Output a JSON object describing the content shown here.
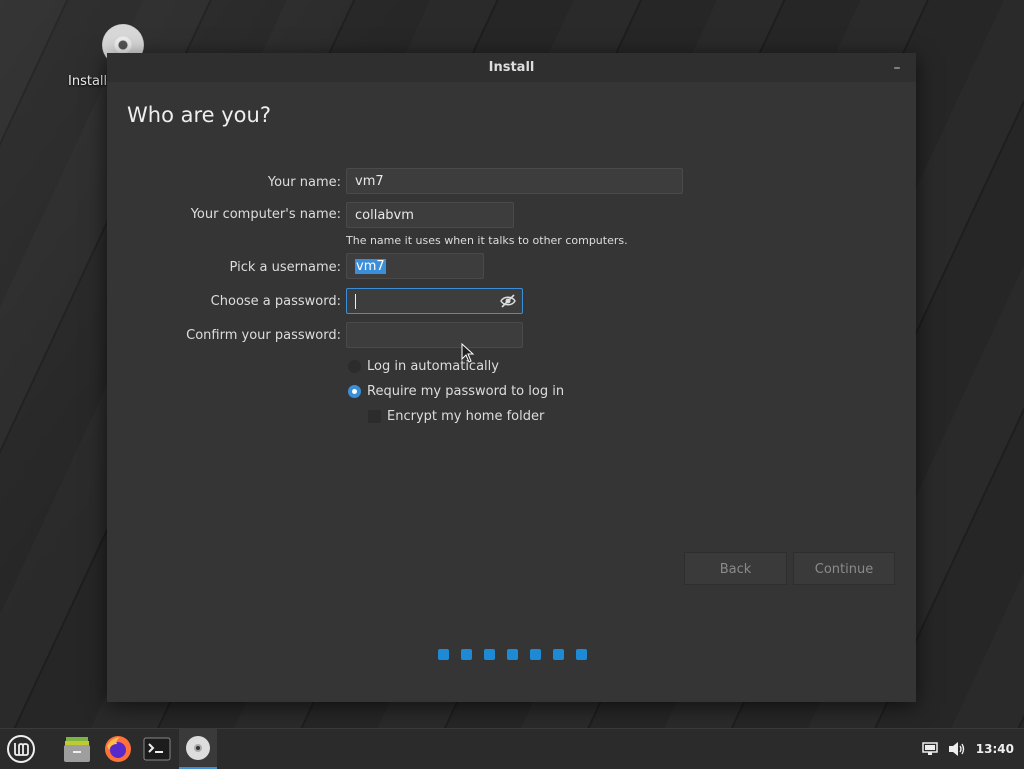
{
  "desktop": {
    "install_icon_label": "Install"
  },
  "window": {
    "title": "Install",
    "heading": "Who are you?",
    "form": {
      "name_label": "Your name:",
      "name_value": "vm7",
      "computer_label": "Your computer's name:",
      "computer_value": "collabvm",
      "computer_hint": "The name it uses when it talks to other computers.",
      "username_label": "Pick a username:",
      "username_value": "vm7",
      "password_label": "Choose a password:",
      "password_value": "",
      "confirm_label": "Confirm your password:",
      "confirm_value": ""
    },
    "options": {
      "auto_login": "Log in automatically",
      "require_password": "Require my password to log in",
      "encrypt_home": "Encrypt my home folder"
    },
    "buttons": {
      "back": "Back",
      "continue": "Continue"
    },
    "progress": {
      "steps": 7
    }
  },
  "taskbar": {
    "apps": [
      "menu-icon",
      "files-icon",
      "firefox-icon",
      "terminal-icon",
      "installer-icon"
    ],
    "clock": "13:40"
  },
  "colors": {
    "accent": "#3b8fd8",
    "window_bg": "#353535",
    "progress_dot": "#1e8ad6"
  }
}
